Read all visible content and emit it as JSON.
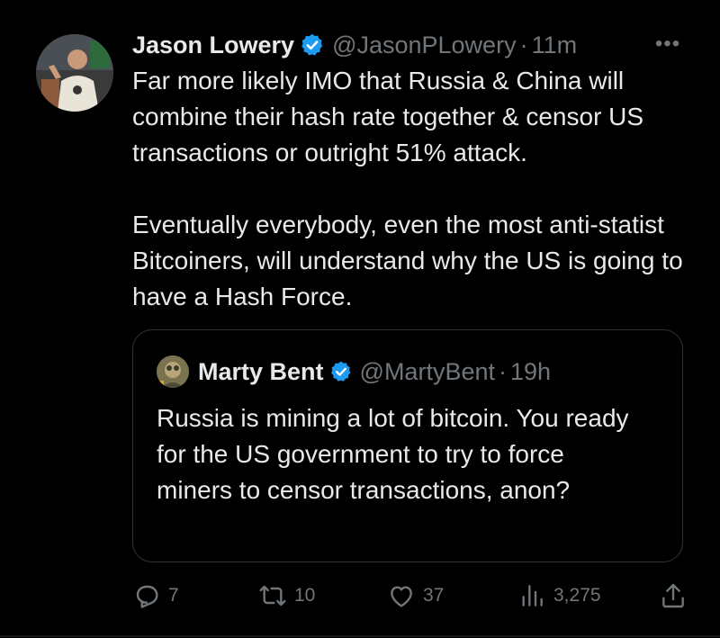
{
  "tweet": {
    "author": {
      "display_name": "Jason Lowery",
      "handle": "@JasonPLowery",
      "verified": true
    },
    "separator": "·",
    "time": "11m",
    "more_label": "•••",
    "paragraphs": [
      "Far more likely IMO that Russia & China will combine their hash rate together & censor US transactions or outright 51% attack.",
      "Eventually everybody, even the most anti-statist Bitcoiners, will understand why the US is going to have a Hash Force."
    ]
  },
  "quoted_tweet": {
    "author": {
      "display_name": "Marty Bent",
      "handle": "@MartyBent",
      "verified": true
    },
    "separator": "·",
    "time": "19h",
    "text": "Russia is mining a lot of bitcoin. You ready for the US government to try to force miners to censor transactions, anon?"
  },
  "actions": {
    "replies": "7",
    "retweets": "10",
    "likes": "37",
    "views": "3,275"
  },
  "colors": {
    "background": "#000000",
    "text": "#e7e9ea",
    "secondary": "#71767b",
    "verified_blue": "#1d9bf0",
    "border": "#2f3336"
  }
}
